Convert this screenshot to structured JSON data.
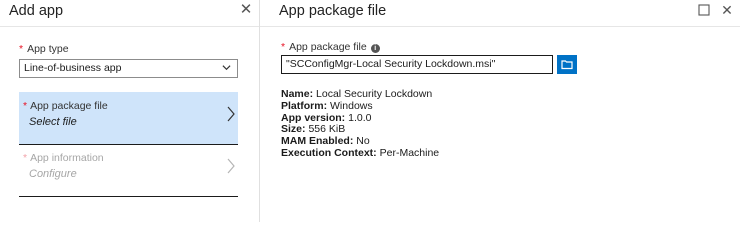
{
  "left": {
    "title": "Add app",
    "app_type": {
      "label": "App type",
      "value": "Line-of-business app"
    },
    "nav": [
      {
        "label": "App package file",
        "sub": "Select file",
        "required": true,
        "state": "active"
      },
      {
        "label": "App information",
        "sub": "Configure",
        "required": true,
        "state": "disabled"
      }
    ]
  },
  "right": {
    "title": "App package file",
    "field_label": "App package file",
    "file_value": "\"SCConfigMgr-Local Security Lockdown.msi\"",
    "details": [
      {
        "key": "Name:",
        "value": "Local Security Lockdown"
      },
      {
        "key": "Platform:",
        "value": "Windows"
      },
      {
        "key": "App version:",
        "value": "1.0.0"
      },
      {
        "key": "Size:",
        "value": "556 KiB"
      },
      {
        "key": "MAM Enabled:",
        "value": "No"
      },
      {
        "key": "Execution Context:",
        "value": "Per-Machine"
      }
    ]
  },
  "colors": {
    "accent": "#0072c6",
    "selected_bg": "#cfe4fa",
    "required": "#e81123"
  },
  "icons": {
    "close": "close-icon",
    "maximize": "maximize-icon",
    "chevron": "chevron-down-icon",
    "arrow": "chevron-right-icon",
    "info": "info-icon",
    "folder": "folder-icon"
  }
}
